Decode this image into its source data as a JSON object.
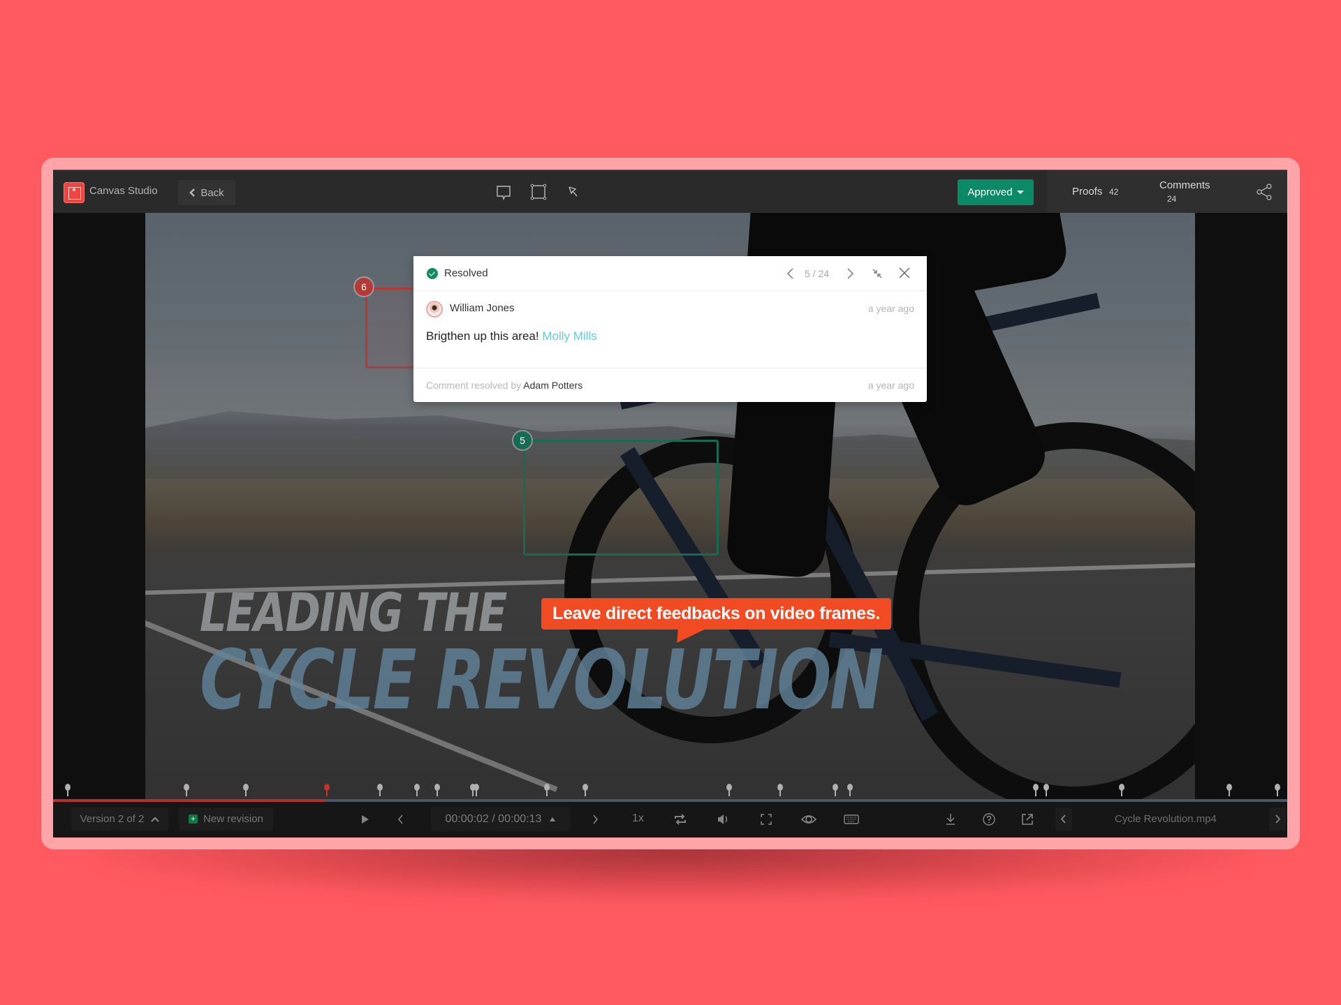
{
  "app": {
    "name": "Canvas Studio",
    "logo_icon": "canvas-studio-logo-icon"
  },
  "toolbar": {
    "back_label": "Back",
    "tools": [
      {
        "name": "comment-tool",
        "icon": "speech-bubble-icon"
      },
      {
        "name": "rectangle-tool",
        "icon": "rectangle-select-icon"
      },
      {
        "name": "pointer-tool",
        "icon": "arrow-pointer-icon"
      }
    ],
    "status_label": "Approved",
    "proofs_label": "Proofs",
    "proofs_count": "42",
    "comments_label": "Comments",
    "comments_count": "24",
    "share_icon": "share-icon"
  },
  "video": {
    "overlay_line1": "LEADING THE",
    "overlay_line2": "CYCLE REVOLUTION",
    "annotations": [
      {
        "number": "6",
        "color": "#b53a35"
      },
      {
        "number": "5",
        "color": "#166b52"
      }
    ],
    "callout": "Leave direct feedbacks on video frames."
  },
  "comment_popover": {
    "status": "Resolved",
    "status_color": "#138a66",
    "position": "5 / 24",
    "author": "William Jones",
    "author_time": "a year ago",
    "body": "Brigthen up this area!",
    "mention": "Molly Mills",
    "mention_color": "#6cc5de",
    "resolved_prefix": "Comment resolved by",
    "resolved_by": "Adam Potters",
    "resolved_time": "a year ago"
  },
  "timeline": {
    "progress": 0.22,
    "played_color": "#b5302c",
    "markers": [
      0.012,
      0.108,
      0.156,
      0.222,
      0.265,
      0.295,
      0.311,
      0.34,
      0.343,
      0.4,
      0.431,
      0.548,
      0.589,
      0.634,
      0.646,
      0.796,
      0.805,
      0.866,
      0.953,
      0.992
    ],
    "active_marker_index": 3
  },
  "controls": {
    "version_label": "Version 2 of 2",
    "new_revision_label": "New revision",
    "current_time": "00:00:02",
    "duration": "00:00:13",
    "time_display": "00:00:02 / 00:00:13",
    "speed": "1x",
    "file_name": "Cycle Revolution.mp4"
  },
  "colors": {
    "background": "#ff5a5f",
    "accent_green": "#0b8a67",
    "callout_orange": "#f24a23"
  }
}
